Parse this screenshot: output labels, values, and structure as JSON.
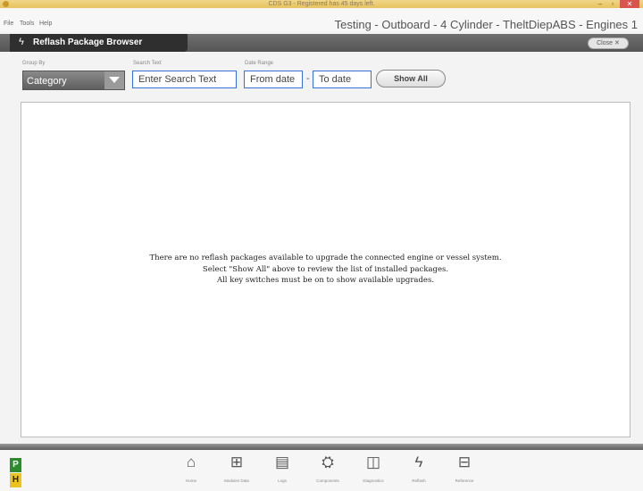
{
  "window": {
    "title": "CDS G3 - Registered has 45 days left.",
    "min": "–",
    "max": "▫",
    "close": "✕"
  },
  "menu": {
    "items": [
      "File",
      "Tools",
      "Help"
    ]
  },
  "engine_title": "Testing - Outboard - 4 Cylinder - TheltDiepABS - Engines 1",
  "module": {
    "title": "Reflash Package Browser",
    "close_label": "Close",
    "close_glyph": "✕",
    "icon": "bolt-icon"
  },
  "filters": {
    "group_by_label": "Group By",
    "group_by_value": "Category",
    "search_label": "Search Text",
    "search_value": "Enter Search Text",
    "date_range_label": "Date Range",
    "from_date": "From date",
    "to_date": "To date",
    "separator": "-",
    "show_all": "Show All"
  },
  "message": {
    "line1": "There are no reflash packages available to upgrade the connected engine or vessel system.",
    "line2": "Select \"Show All\" above to review the list of installed packages.",
    "line3": "All key switches must be on to show available upgrades."
  },
  "indicators": {
    "p": "P",
    "h": "H"
  },
  "nav": [
    {
      "icon": "home-icon",
      "glyph": "⌂",
      "label": "Home"
    },
    {
      "icon": "modules-icon",
      "glyph": "⊞",
      "label": "Modules Data"
    },
    {
      "icon": "logs-icon",
      "glyph": "▤",
      "label": "Logs"
    },
    {
      "icon": "components-icon",
      "glyph": "⛭",
      "label": "Components"
    },
    {
      "icon": "diagnostics-icon",
      "glyph": "◫",
      "label": "Diagnostics"
    },
    {
      "icon": "reflash-icon",
      "glyph": "ϟ",
      "label": "Reflash"
    },
    {
      "icon": "reference-icon",
      "glyph": "⊟",
      "label": "Reference"
    }
  ],
  "colors": {
    "titlebar": "#e8c35e",
    "header_dark": "#2f2f2f",
    "input_border": "#3a6fd8",
    "p_indicator": "#2d8a2d",
    "h_indicator": "#e8c321"
  }
}
